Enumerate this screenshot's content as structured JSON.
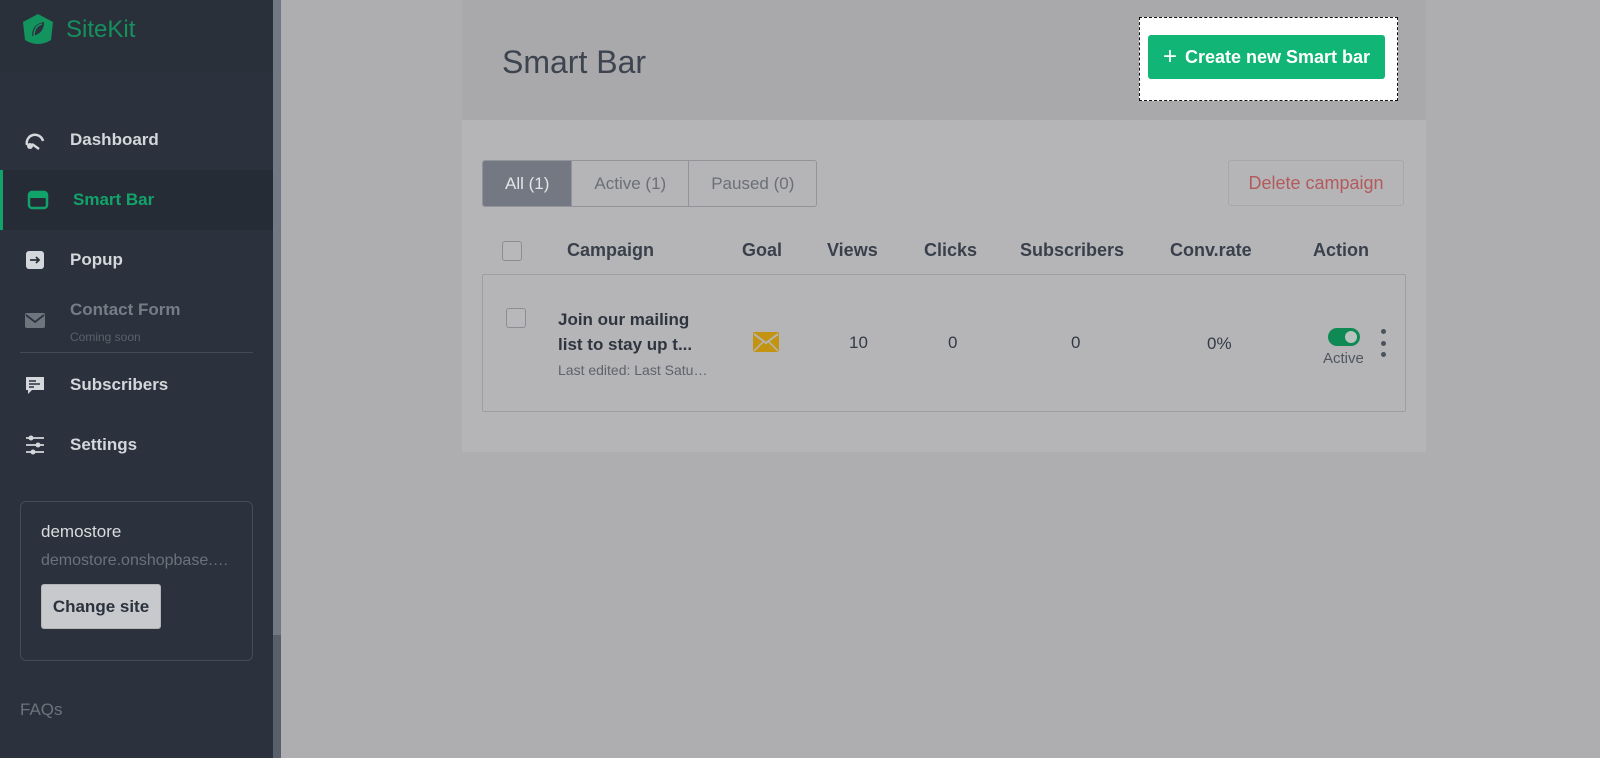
{
  "app": {
    "name": "SiteKit",
    "brand_color": "#12a36a"
  },
  "sidebar": {
    "items": [
      {
        "label": "Dashboard",
        "icon": "gauge-icon"
      },
      {
        "label": "Smart Bar",
        "icon": "smart-bar-icon",
        "active": true
      },
      {
        "label": "Popup",
        "icon": "popup-icon"
      },
      {
        "label": "Contact Form",
        "sub": "Coming soon",
        "icon": "envelope-icon",
        "disabled": true
      },
      {
        "label": "Subscribers",
        "icon": "subscribers-icon"
      },
      {
        "label": "Settings",
        "icon": "sliders-icon"
      }
    ],
    "site": {
      "name": "demostore",
      "url": "demostore.onshopbase.com",
      "change_label": "Change site"
    },
    "faqs": "FAQs"
  },
  "main": {
    "title": "Smart Bar",
    "create_label": "Create new Smart bar",
    "tabs": [
      {
        "label": "All (1)",
        "active": true
      },
      {
        "label": "Active (1)"
      },
      {
        "label": "Paused (0)"
      }
    ],
    "delete_label": "Delete campaign",
    "columns": [
      "Campaign",
      "Goal",
      "Views",
      "Clicks",
      "Subscribers",
      "Conv.rate",
      "Action"
    ],
    "rows": [
      {
        "campaign": "Join our mailing list to stay up t...",
        "edited": "Last edited: Last Saturday",
        "goal_icon": "envelope-icon",
        "views": "10",
        "clicks": "0",
        "subscribers": "0",
        "conv_rate": "0%",
        "status": "Active"
      }
    ]
  }
}
